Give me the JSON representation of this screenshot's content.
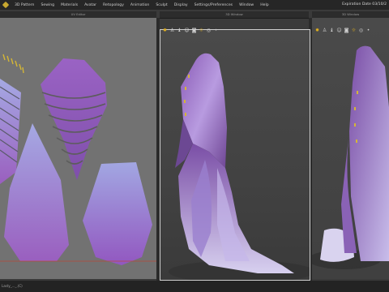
{
  "menubar": {
    "items": [
      "3D Pattern",
      "Sewing",
      "Materials",
      "Avatar",
      "Retopology",
      "Animation",
      "Sculpt",
      "Display",
      "Settings/Preferences",
      "Window",
      "Help"
    ],
    "expiration": "Expiration Date 03/10/2"
  },
  "windows": {
    "pattern_2d": {
      "title": "UV Editor"
    },
    "avatar_3d": {
      "title": "3D Window"
    },
    "avatar_3d_b": {
      "title": "3D Window"
    }
  },
  "toolbar_icons": [
    "sun-icon",
    "avatar-icon",
    "garment-icon",
    "person-icon",
    "camera-icon",
    "light-icon",
    "target-icon",
    "dot-icon"
  ],
  "status": {
    "text": "Lasty_..._.(C)"
  },
  "colors": {
    "panel_bg": "#727272",
    "viewport_bg": "#444444",
    "fabric": "#9b6fc2",
    "pattern_fill_top": "#8f5fba",
    "pattern_fill_bottom": "#a3a6df",
    "accent": "#c8a830"
  }
}
